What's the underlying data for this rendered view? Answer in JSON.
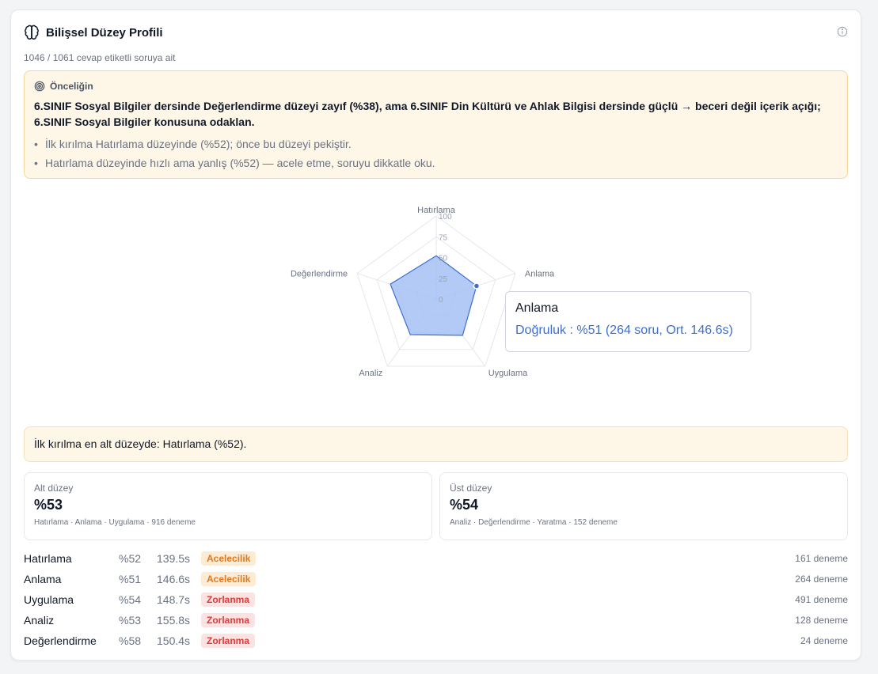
{
  "header": {
    "title": "Bilişsel Düzey Profili",
    "subtitle": "1046 / 1061 cevap etiketli soruya ait"
  },
  "priority": {
    "title": "Önceliğin",
    "main": "6.SINIF Sosyal Bilgiler dersinde Değerlendirme düzeyi zayıf (%38), ama 6.SINIF Din Kültürü ve Ahlak Bilgisi dersinde güçlü → beceri değil içerik açığı; 6.SINIF Sosyal Bilgiler konusuna odaklan.",
    "bullets": [
      "İlk kırılma Hatırlama düzeyinde (%52); önce bu düzeyi pekiştir.",
      "Hatırlama düzeyinde hızlı ama yanlış (%52) — acele etme, soruyu dikkatle oku."
    ]
  },
  "chart_data": {
    "type": "radar",
    "axes": [
      "Hatırlama",
      "Anlama",
      "Uygulama",
      "Analiz",
      "Değerlendirme"
    ],
    "ticks": [
      "0",
      "25",
      "50",
      "75",
      "100"
    ],
    "range": [
      0,
      100
    ],
    "values": [
      52,
      51,
      54,
      53,
      58
    ],
    "fill_color": "#a6c1f5",
    "stroke_color": "#3b6fd1",
    "highlighted_axis": "Anlama"
  },
  "tooltip": {
    "title": "Anlama",
    "value": "Doğruluk : %51 (264 soru, Ort. 146.6s)"
  },
  "lowest_text": "İlk kırılma en alt düzeyde: Hatırlama (%52).",
  "levels": [
    {
      "label": "Alt düzey",
      "value": "%53",
      "detail": "Hatırlama · Anlama · Uygulama · 916 deneme"
    },
    {
      "label": "Üst düzey",
      "value": "%54",
      "detail": "Analiz · Değerlendirme · Yaratma · 152 deneme"
    }
  ],
  "rows": [
    {
      "name": "Hatırlama",
      "acc": "%52",
      "time": "139.5s",
      "badge": "Acelecilik",
      "count": "161 deneme"
    },
    {
      "name": "Anlama",
      "acc": "%51",
      "time": "146.6s",
      "badge": "Acelecilik",
      "count": "264 deneme"
    },
    {
      "name": "Uygulama",
      "acc": "%54",
      "time": "148.7s",
      "badge": "Zorlanma",
      "count": "491 deneme"
    },
    {
      "name": "Analiz",
      "acc": "%53",
      "time": "155.8s",
      "badge": "Zorlanma",
      "count": "128 deneme"
    },
    {
      "name": "Değerlendirme",
      "acc": "%58",
      "time": "150.4s",
      "badge": "Zorlanma",
      "count": "24 deneme"
    }
  ]
}
